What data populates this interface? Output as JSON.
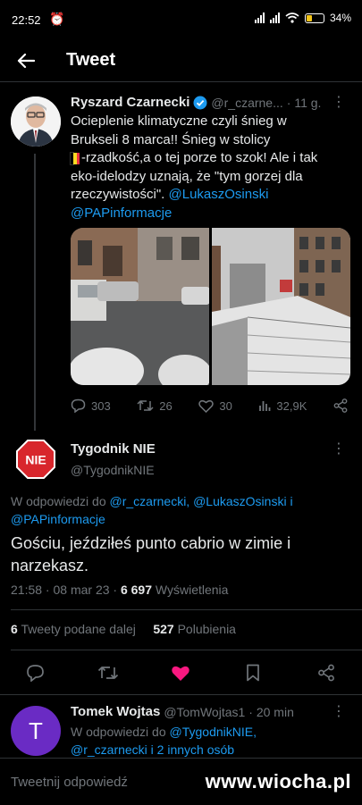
{
  "status": {
    "time": "22:52",
    "battery": "34"
  },
  "header": {
    "title": "Tweet"
  },
  "parent_tweet": {
    "author": "Ryszard Czarnecki",
    "handle": "@r_czarne...",
    "time": "· 11 g.",
    "text_line1": "Ocieplenie klimatyczne czyli śnieg w",
    "text_line2": "Brukseli 8 marca!! Śnieg w stolicy",
    "text_line3": "-rzadkość,a o tej porze to szok! Ale i tak",
    "text_line4": "eko-idelodzy uznają, że \"tym gorzej dla",
    "text_line5": "rzeczywistości\".",
    "mention1": "@LukaszOsinski",
    "mention2": "@PAPinformacje",
    "replies": "303",
    "retweets": "26",
    "likes": "30",
    "views": "32,9K"
  },
  "main_tweet": {
    "author": "Tygodnik NIE",
    "handle": "@TygodnikNIE",
    "logo_text": "NIE",
    "reply_prefix": "W odpowiedzi do",
    "reply_user1": "@r_czarnecki,",
    "reply_user2": "@LukaszOsinski i",
    "reply_user3": "@PAPinformacje",
    "text_line1": "Gościu, jeździłeś punto cabrio w zimie i",
    "text_line2": "narzekasz.",
    "timestamp": "21:58 · 08 mar 23 ·",
    "views_count": "6 697",
    "views_label": "Wyświetlenia",
    "retweets_count": "6",
    "retweets_label": "Tweety podane dalej",
    "likes_count": "527",
    "likes_label": "Polubienia"
  },
  "reply_tweet": {
    "avatar_letter": "T",
    "author": "Tomek Wojtas",
    "handle": "@TomWojtas1",
    "time": "· 20 min",
    "reply_prefix": "W odpowiedzi do",
    "reply_user1": "@TygodnikNIE,",
    "reply_user2": "@r_czarnecki i 2 innych osób"
  },
  "composer": {
    "placeholder": "Tweetnij odpowiedź"
  },
  "watermark": "www.wiocha.pl",
  "colors": {
    "accent": "#1d9bf0",
    "like": "#f91880",
    "verified": "#1d9bf0"
  }
}
